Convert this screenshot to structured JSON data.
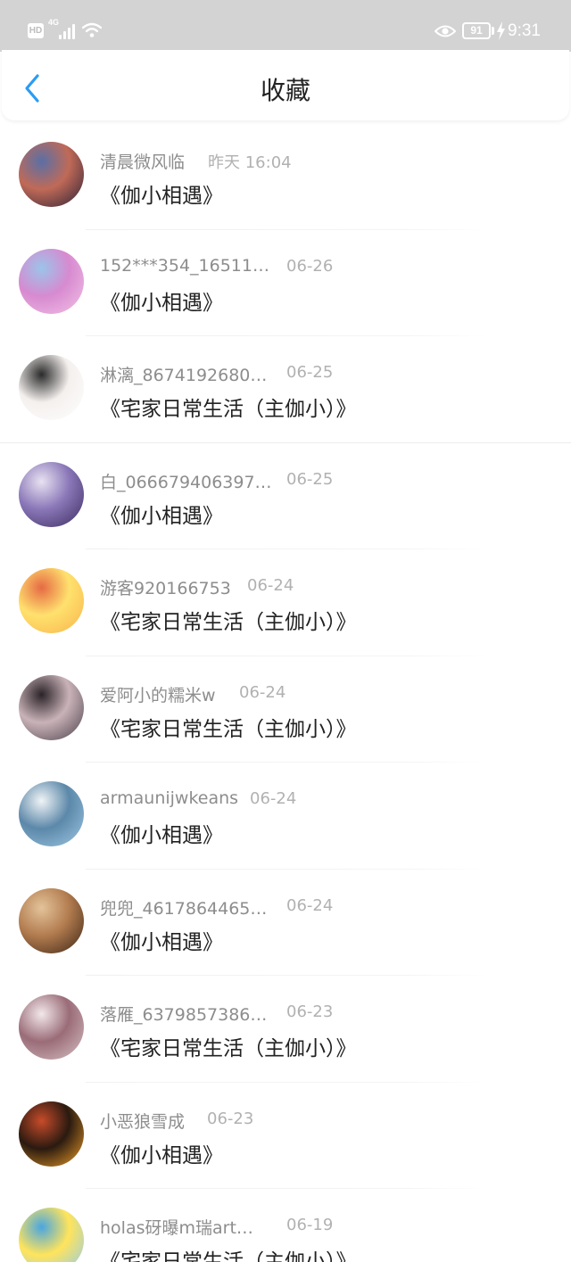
{
  "status_bar": {
    "hd": "HD",
    "network": "4G",
    "battery": "91",
    "time": "9:31"
  },
  "header": {
    "title": "收藏"
  },
  "items": [
    {
      "user": "清晨微风临",
      "time": "昨天 16:04",
      "title": "《伽小相遇》",
      "avatar_colors": [
        "#2a2036",
        "#c06a57",
        "#5a6fa6"
      ]
    },
    {
      "user": "152***354_16511…",
      "time": "06-26",
      "title": "《伽小相遇》",
      "avatar_colors": [
        "#f3c3e6",
        "#d78ad0",
        "#9bc4ea"
      ]
    },
    {
      "user": "淋漓_8674192680…",
      "time": "06-25",
      "title": "《宅家日常生活（主伽小）》",
      "avatar_colors": [
        "#ffffff",
        "#f4f0ee",
        "#2a2a2a"
      ]
    },
    {
      "user": "白_066679406397…",
      "time": "06-25",
      "title": "《伽小相遇》",
      "avatar_colors": [
        "#3b2c5e",
        "#8a77b8",
        "#e8e2f1"
      ]
    },
    {
      "user": "游客920166753",
      "time": "06-24",
      "title": "《宅家日常生活（主伽小）》",
      "avatar_colors": [
        "#f7b34a",
        "#ffe16e",
        "#e66a44"
      ]
    },
    {
      "user": "爱阿小的糯米w",
      "time": "06-24",
      "title": "《宅家日常生活（主伽小）》",
      "avatar_colors": [
        "#4a3e48",
        "#c9b3b8",
        "#2b2328"
      ]
    },
    {
      "user": "armaunijwkeans",
      "time": "06-24",
      "title": "《伽小相遇》",
      "avatar_colors": [
        "#9fc8e4",
        "#5c88a9",
        "#f0f4f6"
      ]
    },
    {
      "user": "兜兜_4617864465…",
      "time": "06-24",
      "title": "《伽小相遇》",
      "avatar_colors": [
        "#3b2415",
        "#b27c4f",
        "#e4c39a"
      ]
    },
    {
      "user": "落雁_6379857386…",
      "time": "06-23",
      "title": "《宅家日常生活（主伽小）》",
      "avatar_colors": [
        "#d8c2c6",
        "#9a6c78",
        "#f2e8ea"
      ]
    },
    {
      "user": "小恶狼雪成",
      "time": "06-23",
      "title": "《伽小相遇》",
      "avatar_colors": [
        "#f2a12a",
        "#2a1a10",
        "#c74b2a"
      ]
    },
    {
      "user": "holas砑曝m瑞art…",
      "time": "06-19",
      "title": "《宅家日常生活（主伽小）》",
      "avatar_colors": [
        "#8ecbf0",
        "#ffe45c",
        "#4aa6e0"
      ]
    }
  ]
}
